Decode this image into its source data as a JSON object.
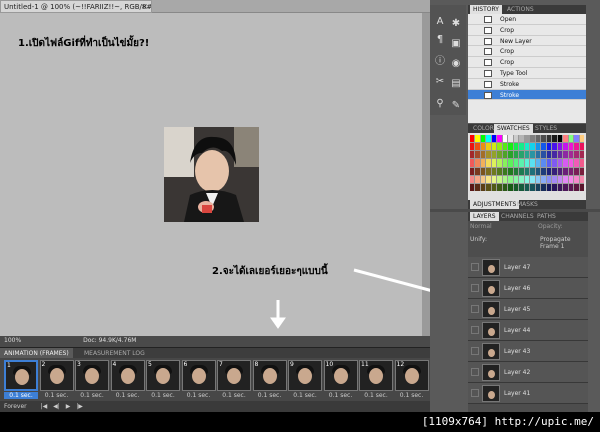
{
  "document": {
    "tab_title": "Untitled-1 @ 100% (~!!FARIIZ!!~, RGB/8#) *",
    "close": "×"
  },
  "annotations": {
    "note1": "1.เปิดไฟล์Gifที่ทำเป็นไข่มั้ย?!",
    "note2": "2.จะได้เลเยอร์เยอะๆแบบนี้"
  },
  "status_bar": {
    "zoom": "100%",
    "doc": "Doc: 94.9K/4.76M"
  },
  "animation_panel": {
    "tabs": [
      "ANIMATION (FRAMES)",
      "MEASUREMENT LOG"
    ],
    "frames": [
      {
        "num": "1",
        "delay": "0.1 sec."
      },
      {
        "num": "2",
        "delay": "0.1 sec."
      },
      {
        "num": "3",
        "delay": "0.1 sec."
      },
      {
        "num": "4",
        "delay": "0.1 sec."
      },
      {
        "num": "5",
        "delay": "0.1 sec."
      },
      {
        "num": "6",
        "delay": "0.1 sec."
      },
      {
        "num": "7",
        "delay": "0.1 sec."
      },
      {
        "num": "8",
        "delay": "0.1 sec."
      },
      {
        "num": "9",
        "delay": "0.1 sec."
      },
      {
        "num": "10",
        "delay": "0.1 sec."
      },
      {
        "num": "11",
        "delay": "0.1 sec."
      },
      {
        "num": "12",
        "delay": "0.1 sec."
      }
    ],
    "loop": "Forever"
  },
  "history_panel": {
    "tabs": [
      "HISTORY",
      "ACTIONS"
    ],
    "items": [
      "Open",
      "Crop",
      "New Layer",
      "Crop",
      "Crop",
      "Type Tool",
      "Stroke",
      "Stroke"
    ]
  },
  "swatches_panel": {
    "tabs": [
      "COLOR",
      "SWATCHES",
      "STYLES"
    ]
  },
  "adjust_panel": {
    "tabs": [
      "ADJUSTMENTS",
      "MASKS"
    ]
  },
  "layers_panel": {
    "tabs": [
      "LAYERS",
      "CHANNELS",
      "PATHS"
    ],
    "blend_mode": "Normal",
    "opacity_label": "Opacity:",
    "unify_label": "Unify:",
    "propagate_label": "Propagate Frame 1",
    "layers": [
      "Layer 47",
      "Layer 46",
      "Layer 45",
      "Layer 44",
      "Layer 43",
      "Layer 42",
      "Layer 41"
    ]
  },
  "footer": {
    "watermark": "[1109x764] http://upic.me/"
  },
  "colors": {
    "selection": "#3d7fd6",
    "canvas": "#bcbcbc",
    "panel_dark": "#474747"
  }
}
